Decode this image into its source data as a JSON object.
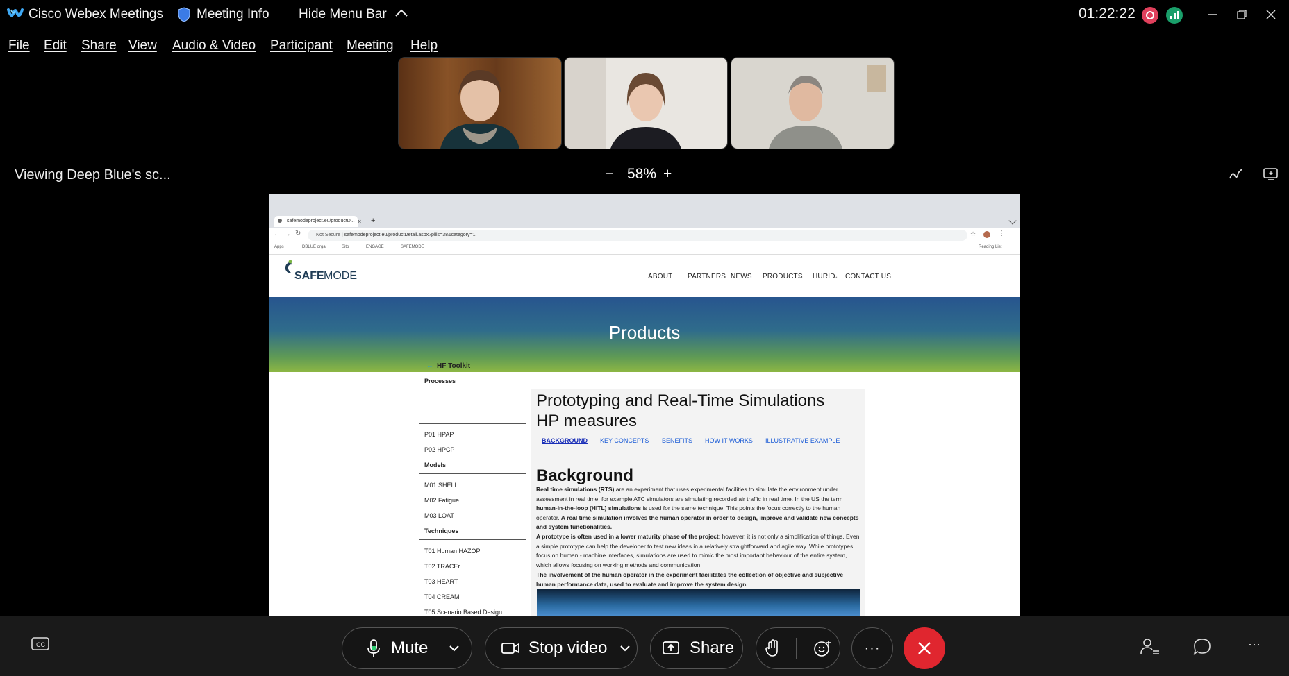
{
  "titlebar": {
    "app_title": "Cisco Webex Meetings",
    "meeting_info": "Meeting Info",
    "hide_menu": "Hide Menu Bar",
    "timer": "01:22:22"
  },
  "menu": [
    "File",
    "Edit",
    "Share",
    "View",
    "Audio & Video",
    "Participant",
    "Meeting",
    "Help"
  ],
  "share_bar": {
    "viewing": "Viewing Deep Blue's sc...",
    "zoom_minus": "−",
    "zoom": "58%",
    "zoom_plus": "+"
  },
  "browser": {
    "tab_title": "safemodeproject.eu/productD...",
    "tab_close": "×",
    "new_tab": "+",
    "not_secure": "Not Secure",
    "url": "safemodeproject.eu/productDetail.aspx?pills=38&category=1",
    "bookmarks": [
      "Apps",
      "DBLUE orga",
      "Sito",
      "ENGAGE",
      "SAFEMODE"
    ],
    "reading_list": "Reading List"
  },
  "site": {
    "logo_safe": "SAFE",
    "logo_mode": "MODE",
    "nav": [
      "ABOUT",
      "PARTNERS",
      "NEWS",
      "PRODUCTS",
      "HURID",
      "CONTACT US"
    ],
    "banner_title": "Products",
    "sidebar": {
      "back": "HF Toolkit",
      "processes": "Processes",
      "process_items": [
        "P01 HPAP",
        "P02 HPCP"
      ],
      "models": "Models",
      "model_items": [
        "M01 SHELL",
        "M02 Fatigue",
        "M03 LOAT"
      ],
      "techniques": "Techniques",
      "technique_items": [
        "T01 Human HAZOP",
        "T02 TRACEr",
        "T03 HEART",
        "T04 CREAM",
        "T05 Scenario Based Design"
      ]
    },
    "page_title_1": "Prototyping and Real-Time Simulations",
    "page_title_2": "HP measures",
    "subnav": [
      "BACKGROUND",
      "KEY CONCEPTS",
      "BENEFITS",
      "HOW IT WORKS",
      "ILLUSTRATIVE EXAMPLE"
    ],
    "section_title": "Background",
    "para1_b1": "Real time simulations (RTS)",
    "para1_t1": " are an experiment that uses experimental facilities to simulate the environment under assessment in real time; for example ATC simulators are simulating recorded air traffic in real time. In the US the term ",
    "para1_b2": "human-in-the-loop (HITL) simulations",
    "para1_t2": " is used for the same technique. This points the focus correctly to the human operator. ",
    "para1_b3": "A real time simulation involves the human operator in order to design, improve and validate new concepts and system functionalities.",
    "para2_b1": "A prototype is often used in a lower maturity phase of the project",
    "para2_t1": "; however, it is not only a simplification of things. Even a simple prototype can help the developer to test new ideas in a relatively straightforward and agile way. While prototypes focus on human - machine interfaces, simulations are used to mimic the most important behaviour of the entire system, which allows focusing on working methods and communication.",
    "para3_b1": "The involvement of the human operator in the experiment facilitates the collection of objective and subjective human performance data, used to evaluate and improve the system design."
  },
  "controls": {
    "mute": "Mute",
    "stop_video": "Stop video",
    "share": "Share",
    "more": "···",
    "right_more": "···"
  },
  "colors": {
    "end_call": "#e0262f",
    "record": "#e0405c",
    "stats": "#1a9f6a",
    "link_blue": "#1a5bd6"
  }
}
